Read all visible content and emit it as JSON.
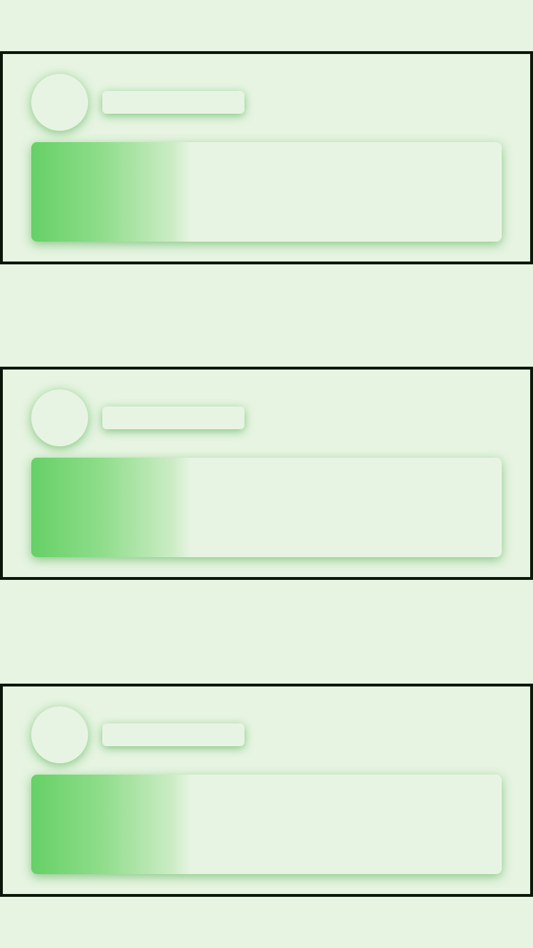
{
  "screen": {
    "state": "loading-skeleton",
    "colors": {
      "background": "#e6f4e1",
      "card_border": "#0c170a",
      "placeholder_fill": "#e8f4e3",
      "shimmer_accent": "#66d066"
    }
  },
  "cards": [
    {
      "avatar_icon": "avatar-placeholder",
      "title": "",
      "content": ""
    },
    {
      "avatar_icon": "avatar-placeholder",
      "title": "",
      "content": ""
    },
    {
      "avatar_icon": "avatar-placeholder",
      "title": "",
      "content": ""
    }
  ]
}
